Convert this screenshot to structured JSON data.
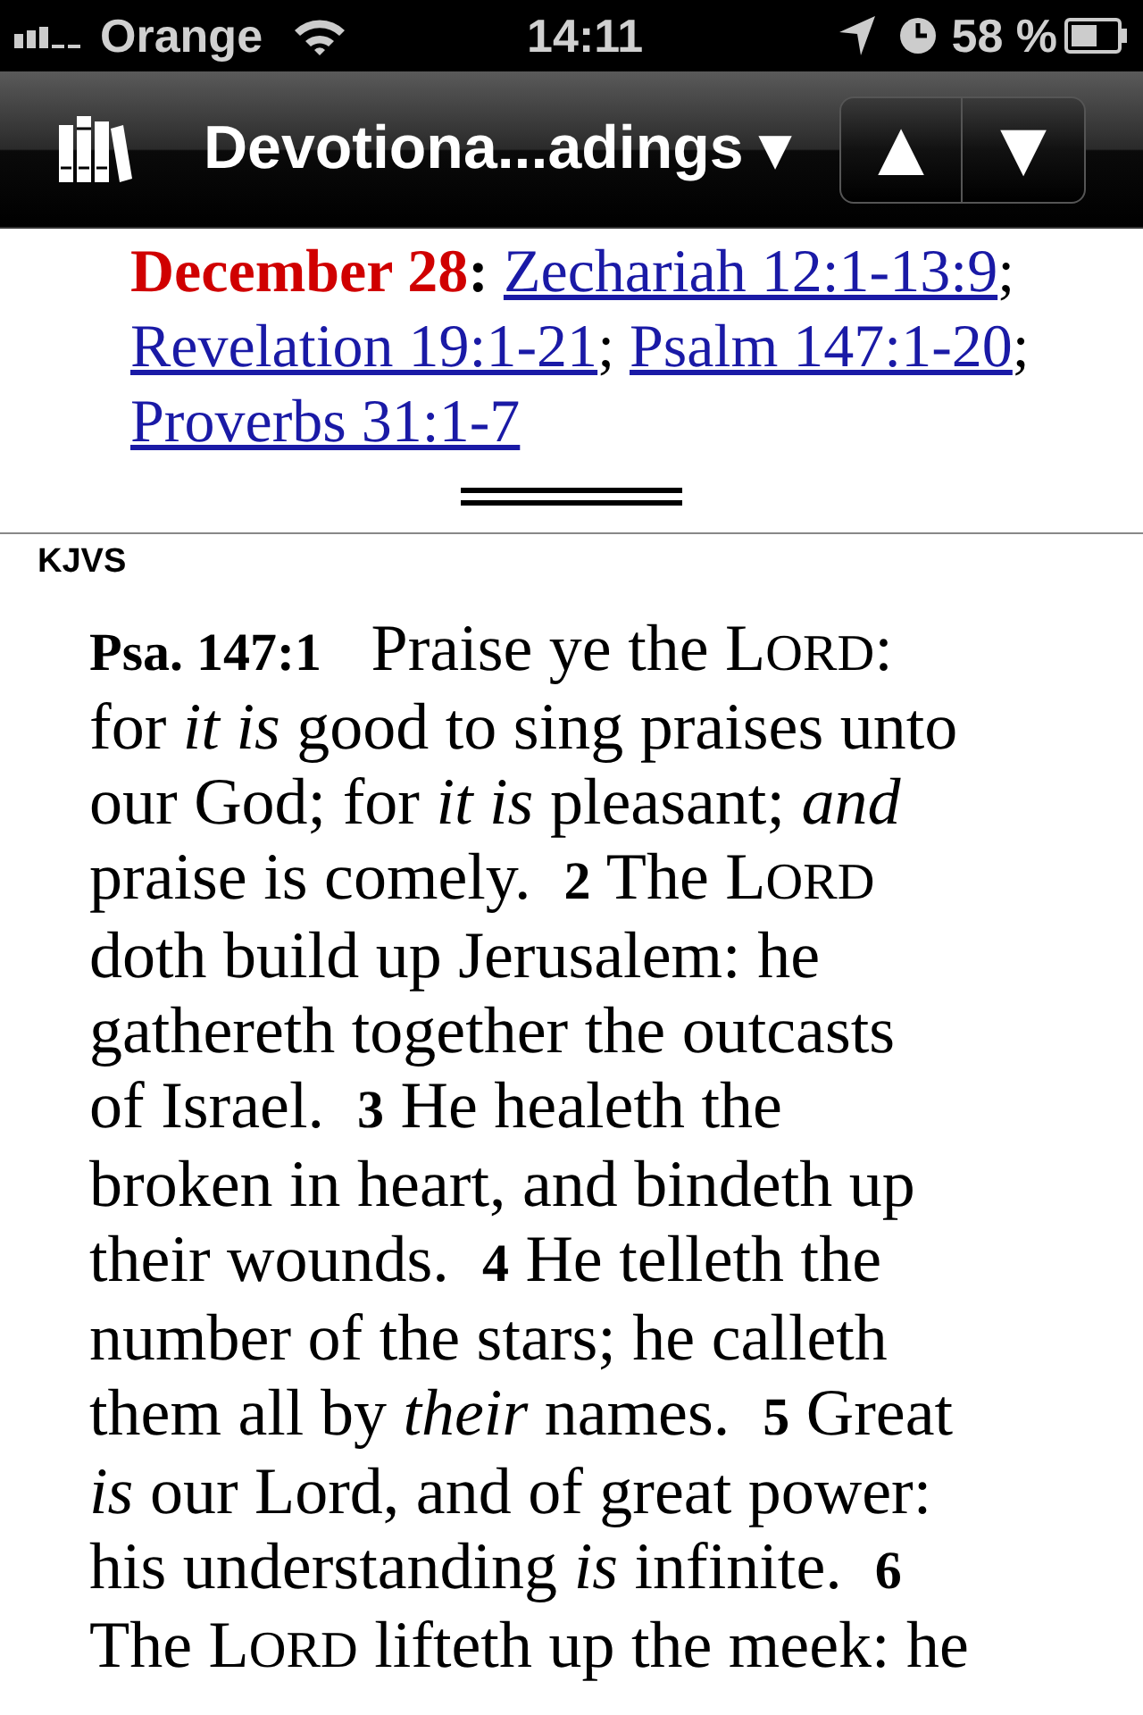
{
  "status_bar": {
    "carrier": "Orange",
    "time": "14:11",
    "battery": "58 %"
  },
  "nav_bar": {
    "title": "Devotiona...adings ▾",
    "up": "▲",
    "down": "▼"
  },
  "heading": {
    "date": "December 28",
    "separator": ":",
    "links": [
      {
        "text": "Zechariah 12:1-13:9",
        "after": "; "
      },
      {
        "text": "Revelation 19:1-21",
        "after": "; "
      },
      {
        "text": "Psalm 147:1-20",
        "after": "; "
      },
      {
        "text": "Proverbs 31:1-7"
      }
    ]
  },
  "module": "KJVS",
  "passage_lines": [
    [
      {
        "kind": "ref",
        "text": "Psa. 147:1"
      },
      {
        "kind": "text",
        "text": "   Praise ye the "
      },
      {
        "kind": "lord",
        "text": "LORD"
      },
      {
        "kind": "text",
        "text": ":"
      }
    ],
    [
      {
        "kind": "text",
        "text": "for "
      },
      {
        "kind": "italic",
        "text": "it is"
      },
      {
        "kind": "text",
        "text": " good to sing praises unto"
      }
    ],
    [
      {
        "kind": "text",
        "text": "our God; for "
      },
      {
        "kind": "italic",
        "text": "it is"
      },
      {
        "kind": "text",
        "text": " pleasant; "
      },
      {
        "kind": "italic",
        "text": "and"
      }
    ],
    [
      {
        "kind": "text",
        "text": "praise is comely.  "
      },
      {
        "kind": "verse",
        "text": "2"
      },
      {
        "kind": "text",
        "text": " The "
      },
      {
        "kind": "lord",
        "text": "LORD"
      }
    ],
    [
      {
        "kind": "text",
        "text": "doth build up Jerusalem: he"
      }
    ],
    [
      {
        "kind": "text",
        "text": "gathereth together the outcasts"
      }
    ],
    [
      {
        "kind": "text",
        "text": "of Israel.  "
      },
      {
        "kind": "verse",
        "text": "3"
      },
      {
        "kind": "text",
        "text": " He healeth the"
      }
    ],
    [
      {
        "kind": "text",
        "text": "broken in heart, and bindeth up"
      }
    ],
    [
      {
        "kind": "text",
        "text": "their wounds.  "
      },
      {
        "kind": "verse",
        "text": "4"
      },
      {
        "kind": "text",
        "text": " He telleth the"
      }
    ],
    [
      {
        "kind": "text",
        "text": "number of the stars; he calleth"
      }
    ],
    [
      {
        "kind": "text",
        "text": "them all by "
      },
      {
        "kind": "italic",
        "text": "their"
      },
      {
        "kind": "text",
        "text": " names.  "
      },
      {
        "kind": "verse",
        "text": "5"
      },
      {
        "kind": "text",
        "text": " Great"
      }
    ],
    [
      {
        "kind": "italic",
        "text": "is"
      },
      {
        "kind": "text",
        "text": " our Lord, and of great power:"
      }
    ],
    [
      {
        "kind": "text",
        "text": "his understanding "
      },
      {
        "kind": "italic",
        "text": "is"
      },
      {
        "kind": "text",
        "text": " infinite.  "
      },
      {
        "kind": "verse",
        "text": "6"
      }
    ],
    [
      {
        "kind": "text",
        "text": "The "
      },
      {
        "kind": "lord",
        "text": "LORD"
      },
      {
        "kind": "text",
        "text": " lifteth up the meek: he"
      }
    ]
  ]
}
